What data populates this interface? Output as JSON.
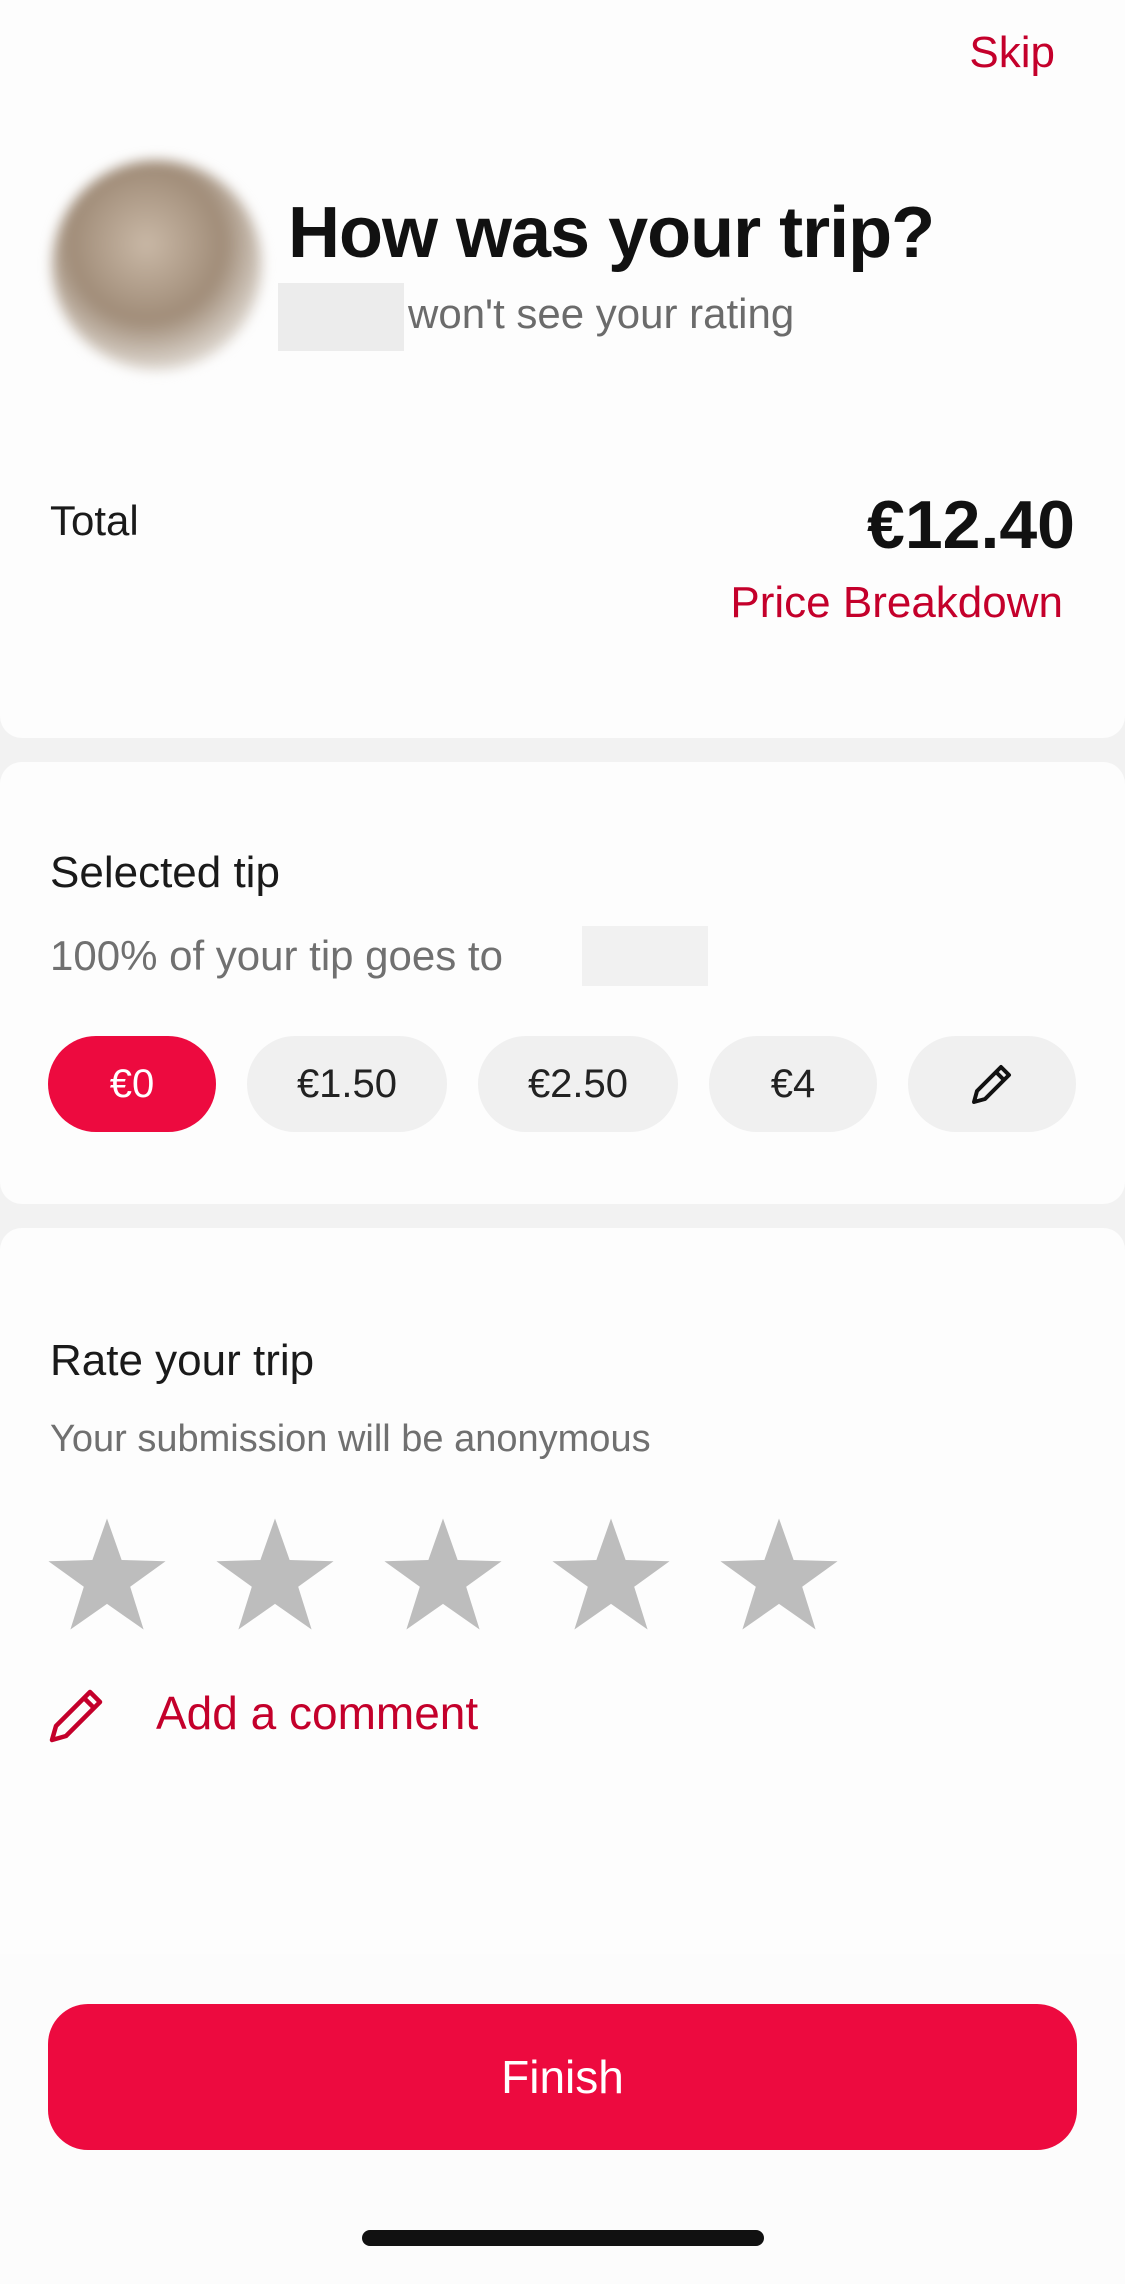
{
  "header": {
    "skip_label": "Skip",
    "title": "How was your trip?",
    "subtitle": "won't see your rating"
  },
  "summary": {
    "total_label": "Total",
    "total_amount": "€12.40",
    "price_breakdown_label": "Price Breakdown"
  },
  "tip": {
    "title": "Selected tip",
    "subtitle": "100% of your tip goes to",
    "options": [
      "€0",
      "€1.50",
      "€2.50",
      "€4"
    ],
    "selected": "€0",
    "custom_icon": "pencil-icon"
  },
  "rating": {
    "title": "Rate your trip",
    "subtitle": "Your submission will be anonymous",
    "max_stars": 5,
    "selected_stars": 0,
    "comment_label": "Add a comment",
    "comment_icon": "pencil-icon"
  },
  "footer": {
    "finish_label": "Finish"
  },
  "colors": {
    "accent": "#ED0A3F",
    "link": "#C4002B",
    "star_inactive": "#BDBDBD",
    "pill_inactive": "#F0F0F0"
  }
}
